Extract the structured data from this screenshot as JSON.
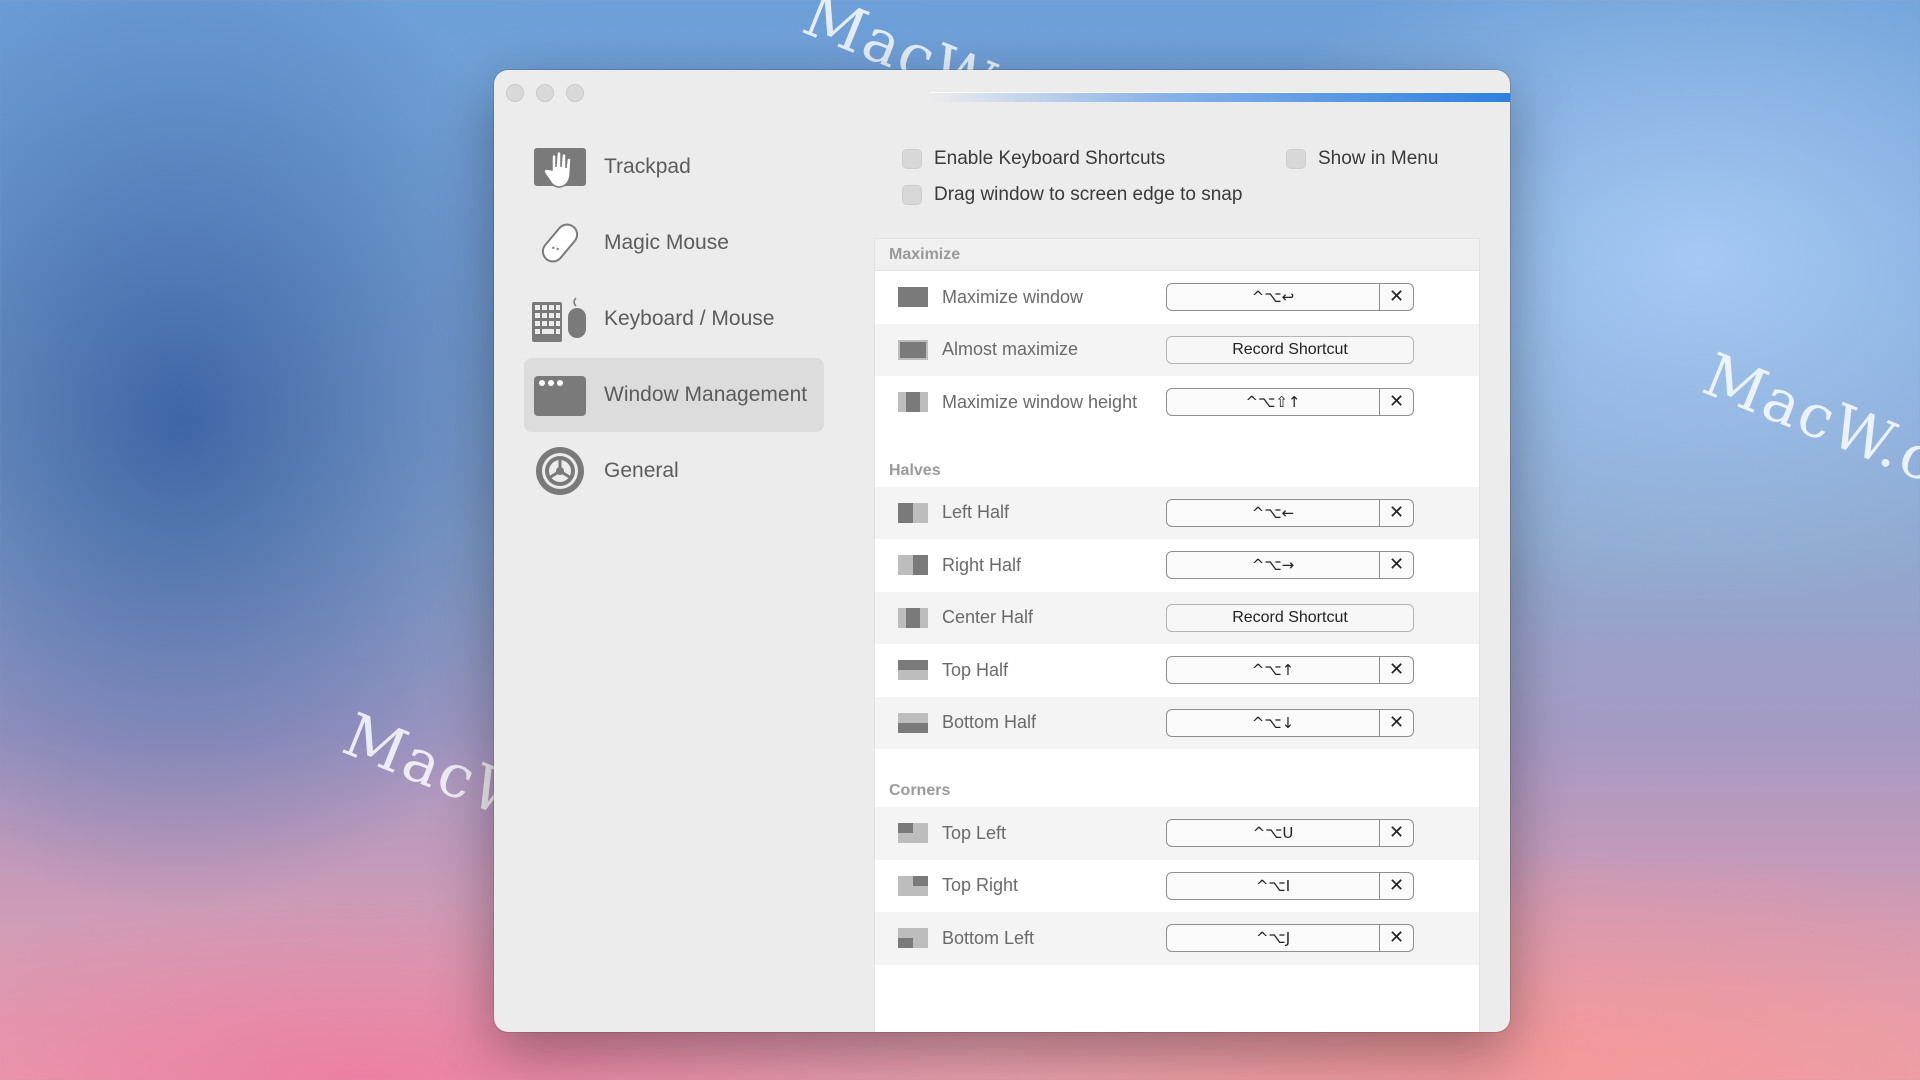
{
  "watermarks": [
    "MacW.com",
    "MacW.com",
    "MacW.com"
  ],
  "sidebar": {
    "items": [
      {
        "label": "Trackpad",
        "icon": "trackpad-hand-icon"
      },
      {
        "label": "Magic Mouse",
        "icon": "magic-mouse-icon"
      },
      {
        "label": "Keyboard / Mouse",
        "icon": "keyboard-mouse-icon"
      },
      {
        "label": "Window Management",
        "icon": "window-management-icon",
        "active": true
      },
      {
        "label": "General",
        "icon": "gear-icon"
      }
    ]
  },
  "options": {
    "enable_shortcuts": "Enable Keyboard Shortcuts",
    "show_in_menu": "Show in Menu",
    "drag_snap": "Drag window to screen edge to snap"
  },
  "sections": {
    "maximize": {
      "title": "Maximize",
      "rows": [
        {
          "label": "Maximize window",
          "shortcut": "^⌥↩",
          "clear": "✕"
        },
        {
          "label": "Almost maximize",
          "record": "Record Shortcut"
        },
        {
          "label": "Maximize window height",
          "shortcut": "^⌥⇧↑",
          "clear": "✕"
        }
      ]
    },
    "halves": {
      "title": "Halves",
      "rows": [
        {
          "label": "Left Half",
          "shortcut": "^⌥←",
          "clear": "✕"
        },
        {
          "label": "Right Half",
          "shortcut": "^⌥→",
          "clear": "✕"
        },
        {
          "label": "Center Half",
          "record": "Record Shortcut"
        },
        {
          "label": "Top Half",
          "shortcut": "^⌥↑",
          "clear": "✕"
        },
        {
          "label": "Bottom Half",
          "shortcut": "^⌥↓",
          "clear": "✕"
        }
      ]
    },
    "corners": {
      "title": "Corners",
      "rows": [
        {
          "label": "Top Left",
          "shortcut": "^⌥U",
          "clear": "✕"
        },
        {
          "label": "Top Right",
          "shortcut": "^⌥I",
          "clear": "✕"
        },
        {
          "label": "Bottom Left",
          "shortcut": "^⌥J",
          "clear": "✕"
        }
      ]
    }
  },
  "colors": {
    "accent_streak": "#2d7fe0",
    "icon_gray": "#7a7a7a"
  }
}
